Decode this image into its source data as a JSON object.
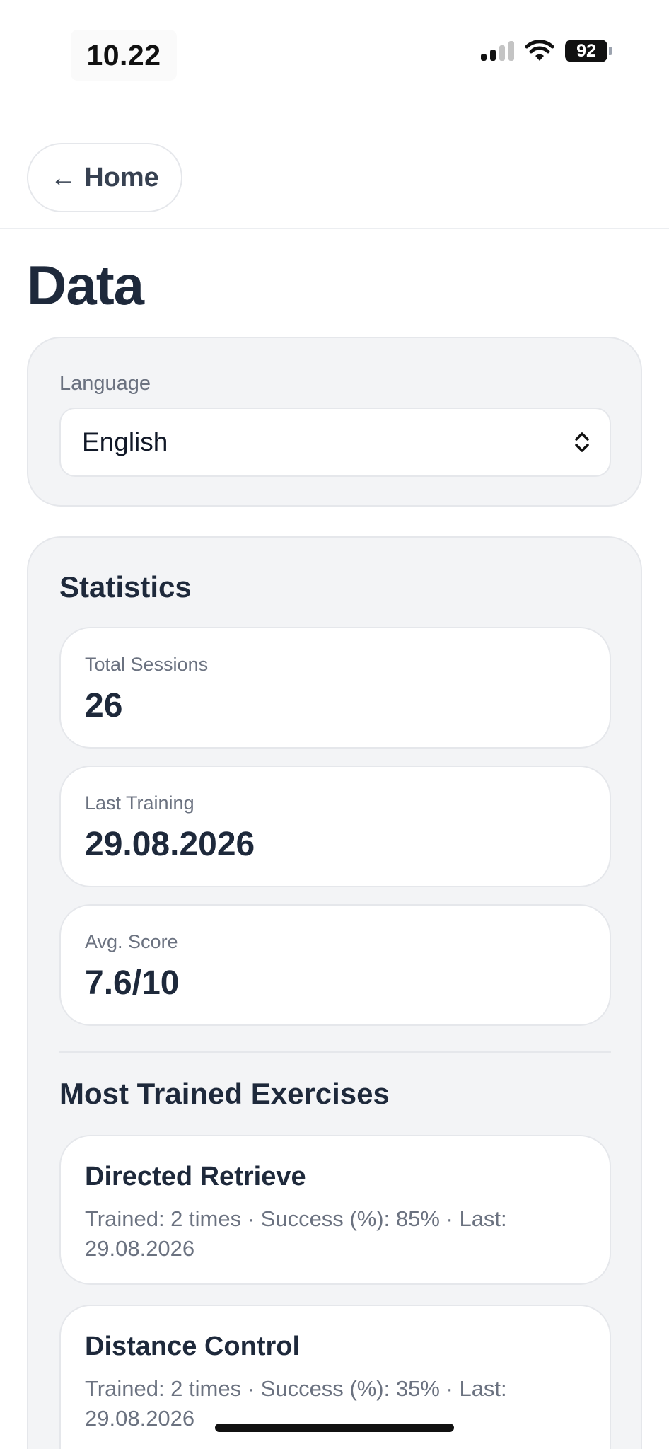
{
  "status_bar": {
    "time": "10.22",
    "battery": "92",
    "icons": [
      "signal-icon",
      "wifi-icon",
      "battery-icon"
    ]
  },
  "header": {
    "home_label": "Home",
    "home_icon": "arrow-left-icon"
  },
  "page_title": "Data",
  "language": {
    "label": "Language",
    "selected": "English"
  },
  "statistics": {
    "title": "Statistics",
    "items": [
      {
        "label": "Total Sessions",
        "value": "26"
      },
      {
        "label": "Last Training",
        "value": "29.08.2026"
      },
      {
        "label": "Avg. Score",
        "value": "7.6/10"
      }
    ]
  },
  "exercises": {
    "title": "Most Trained Exercises",
    "items": [
      {
        "name": "Directed Retrieve",
        "meta": "Trained: 2 times · Success (%): 85% · Last: 29.08.2026"
      },
      {
        "name": "Distance Control",
        "meta": "Trained: 2 times · Success (%): 35% · Last: 29.08.2026"
      }
    ]
  },
  "colors": {
    "text_primary": "#1e293b",
    "text_secondary": "#6b7280",
    "card_bg": "#f3f4f6",
    "border": "#e5e7eb"
  }
}
